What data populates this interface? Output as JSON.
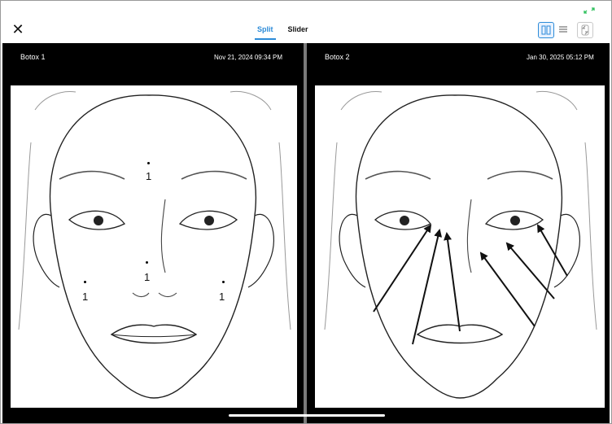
{
  "toolbar": {
    "close_icon": "close-icon",
    "tabs": [
      {
        "label": "Split",
        "active": true
      },
      {
        "label": "Slider",
        "active": false
      }
    ],
    "accent_color": "#2c8bd8",
    "views": [
      "split-vertical-icon",
      "split-horizontal-icon",
      "compare-icon"
    ]
  },
  "left_panel": {
    "title": "Botox 1",
    "date": "Nov 21, 2024 09:34 PM",
    "markers": [
      "1",
      "1",
      "1",
      "1"
    ]
  },
  "right_panel": {
    "title": "Botox 2",
    "date": "Jan 30, 2025 05:12 PM"
  }
}
